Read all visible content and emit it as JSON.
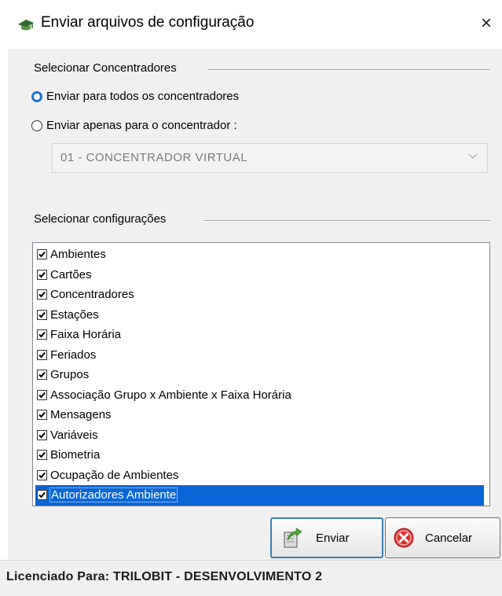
{
  "window": {
    "title": "Enviar arquivos de configuração",
    "close_label": "×"
  },
  "concentradores": {
    "group_title": "Selecionar Concentradores",
    "options": [
      {
        "label": "Enviar para todos os concentradores",
        "checked": true
      },
      {
        "label": "Enviar apenas para o concentrador :",
        "checked": false
      }
    ],
    "combo": {
      "value": "01 - CONCENTRADOR VIRTUAL",
      "enabled": false
    }
  },
  "configuracoes": {
    "group_title": "Selecionar configurações",
    "items": [
      {
        "label": "Ambientes",
        "checked": true
      },
      {
        "label": "Cartões",
        "checked": true
      },
      {
        "label": "Concentradores",
        "checked": true
      },
      {
        "label": "Estações",
        "checked": true
      },
      {
        "label": "Faixa Horária",
        "checked": true
      },
      {
        "label": "Feriados",
        "checked": true
      },
      {
        "label": "Grupos",
        "checked": true
      },
      {
        "label": "Associação Grupo x Ambiente x Faixa Horária",
        "checked": true
      },
      {
        "label": "Mensagens",
        "checked": true
      },
      {
        "label": "Variáveis",
        "checked": true
      },
      {
        "label": "Biometria",
        "checked": true
      },
      {
        "label": "Ocupação de Ambientes",
        "checked": true
      },
      {
        "label": "Autorizadores Ambiente",
        "checked": true,
        "selected": true
      }
    ]
  },
  "buttons": {
    "send_label": "Enviar",
    "cancel_label": "Cancelar"
  },
  "status": {
    "license_text": "Licenciado Para: TRILOBIT - DESENVOLVIMENTO 2"
  },
  "colors": {
    "selection": "#0a66d6",
    "radio_accent": "#1a73d9",
    "dialog_bg": "#f0f0f0"
  },
  "icons": {
    "app": "green-mortarboard-icon",
    "send": "document-arrow-icon",
    "cancel": "red-x-circle-icon"
  }
}
